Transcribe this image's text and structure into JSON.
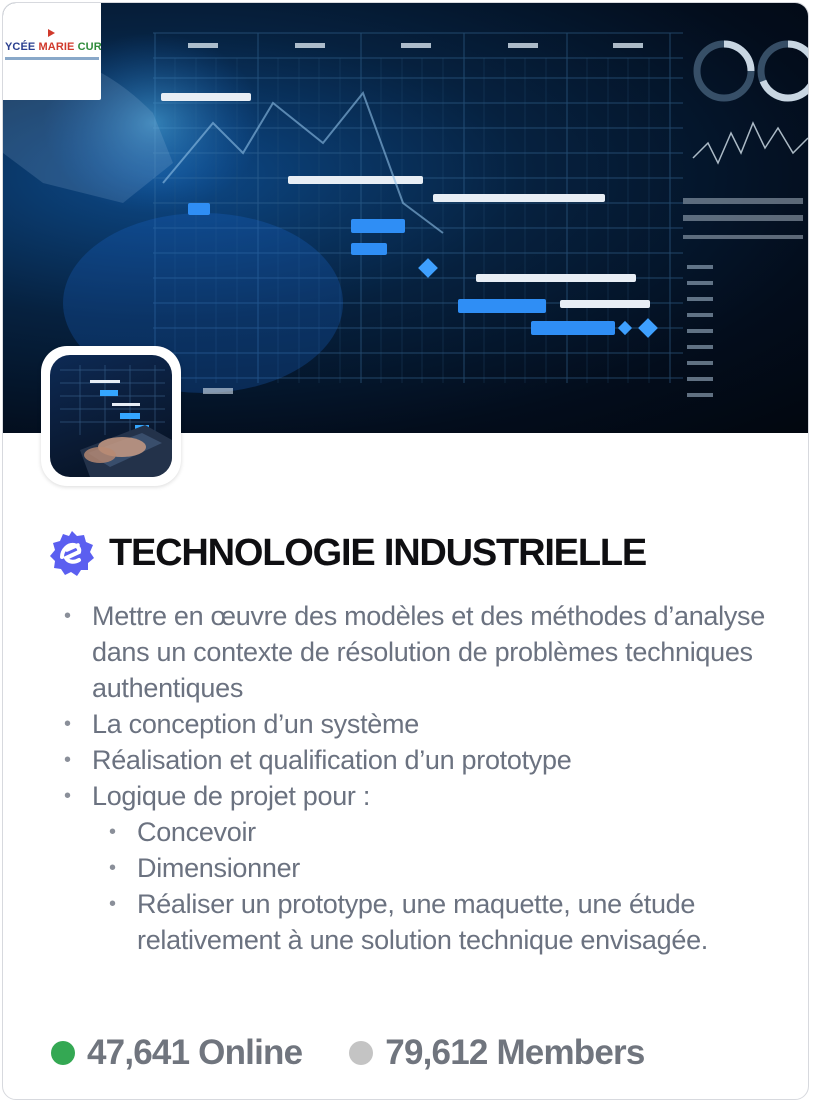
{
  "school_logo": {
    "name_part1": "YCÉE",
    "name_part2": " MARIE",
    "name_part3": " CURI"
  },
  "title": "TECHNOLOGIE INDUSTRIELLE",
  "bullets": [
    "Mettre en œuvre des modèles et des méthodes d’analyse dans un contexte de résolution de problèmes techniques authentiques",
    "La conception d’un système",
    "Réalisation et qualification d’un prototype",
    "Logique de projet pour :"
  ],
  "sub_bullets": [
    "Concevoir",
    "Dimensionner",
    "Réaliser un prototype, une maquette, une étude relativement à une solution technique envisagée."
  ],
  "stats": {
    "online": "47,641 Online",
    "members": "79,612 Members"
  },
  "colors": {
    "online_dot": "#34a853",
    "members_dot": "#c4c4c4",
    "verified_badge": "#5b5ff0",
    "title_text": "#0f0f12",
    "body_text": "#6b7280"
  },
  "icons": {
    "verified": "verified-badge-icon"
  }
}
